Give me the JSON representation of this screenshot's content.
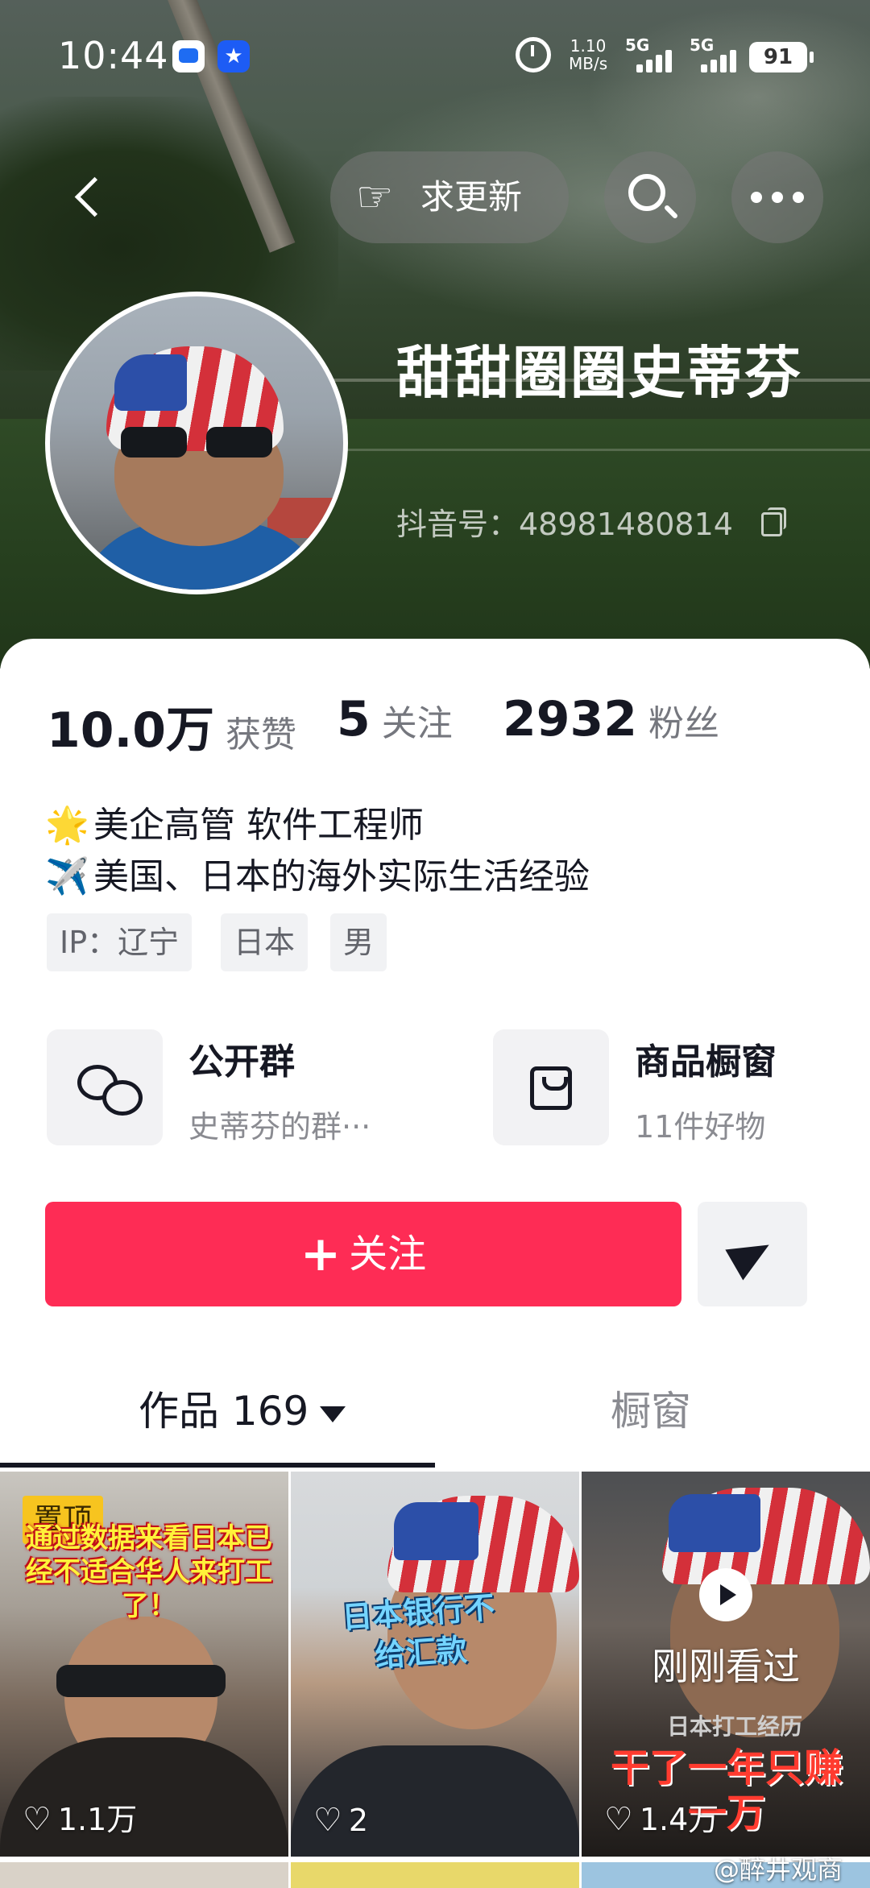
{
  "status_bar": {
    "time": "10:44",
    "net_speed_value": "1.10",
    "net_speed_unit": "MB/s",
    "signal1_label": "5G",
    "signal2_label": "5G",
    "battery": "91"
  },
  "nav": {
    "request_update_label": "求更新",
    "icons": [
      "back-icon",
      "hand-point-icon",
      "search-icon",
      "more-icon"
    ]
  },
  "profile": {
    "name": "甜甜圈圈史蒂芬",
    "douyin_id": "抖音号：48981480814"
  },
  "stats": {
    "likes_value": "10.0万",
    "likes_label": "获赞",
    "following_value": "5",
    "following_label": "关注",
    "followers_value": "2932",
    "followers_label": "粉丝"
  },
  "bio": {
    "line1_icon": "🌟",
    "line1": "美企高管 软件工程师",
    "line2_icon": "✈️",
    "line2": "美国、日本的海外实际生活经验"
  },
  "tags": [
    "IP：辽宁",
    "日本",
    "男"
  ],
  "features": {
    "group_title": "公开群",
    "group_subtitle": "史蒂芬的群···",
    "shop_title": "商品橱窗",
    "shop_subtitle": "11件好物"
  },
  "actions": {
    "follow_plus": "+",
    "follow_label": "关注"
  },
  "tabs": {
    "works_label": "作品 169",
    "window_label": "橱窗"
  },
  "videos": [
    {
      "pinned": "置顶",
      "caption": "通过数据来看日本已经不适合华人来打工了！",
      "likes": "1.1万"
    },
    {
      "caption": "日本银行不给汇款",
      "likes": "2"
    },
    {
      "overlay": "刚刚看过",
      "caption_top": "日本打工经历",
      "caption_main": "干了一年只赚一万",
      "likes": "1.4万"
    }
  ],
  "watermark": "@醉井观商",
  "colors": {
    "follow_button": "#fe2c55",
    "pinned_badge": "#f7c41f",
    "text_primary": "#161823",
    "text_secondary": "#75777e"
  }
}
